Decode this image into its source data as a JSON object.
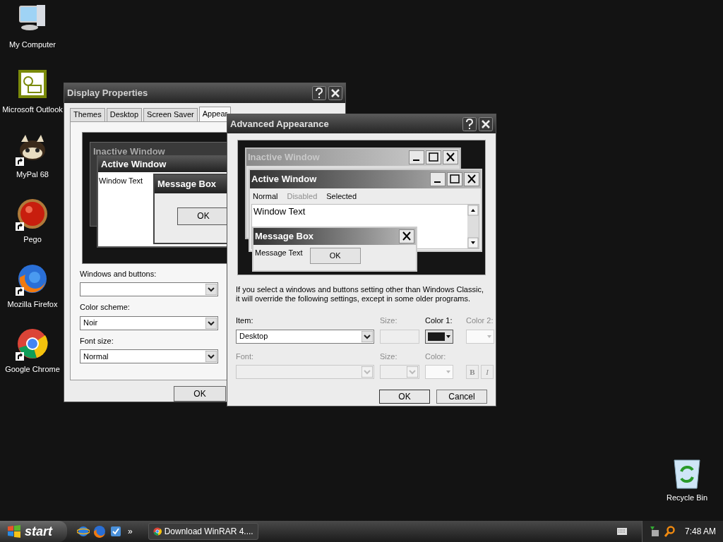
{
  "desktop_icons": [
    {
      "label": "My Computer",
      "kind": "computer",
      "shortcut": false
    },
    {
      "label": "Microsoft Outlook",
      "kind": "outlook",
      "shortcut": false
    },
    {
      "label": "MyPal 68",
      "kind": "raccoon",
      "shortcut": true
    },
    {
      "label": "Pego",
      "kind": "ball",
      "shortcut": true
    },
    {
      "label": "Mozilla Firefox",
      "kind": "firefox",
      "shortcut": true
    },
    {
      "label": "Google Chrome",
      "kind": "chrome",
      "shortcut": true
    }
  ],
  "recycle_bin": {
    "label": "Recycle Bin"
  },
  "display_properties": {
    "title": "Display Properties",
    "tabs": [
      {
        "label": "Themes",
        "selected": false
      },
      {
        "label": "Desktop",
        "selected": false
      },
      {
        "label": "Screen Saver",
        "selected": false
      },
      {
        "label": "Appear",
        "selected": true
      }
    ],
    "preview": {
      "inactive_title": "Inactive Window",
      "active_title": "Active Window",
      "window_text": "Window Text",
      "message_title": "Message Box",
      "ok": "OK"
    },
    "fields": [
      {
        "label": "Windows and buttons:"
      },
      {
        "label": "Color scheme:",
        "value": "Noir"
      },
      {
        "label": "Font size:",
        "value": "Normal"
      }
    ],
    "ok_button": "OK"
  },
  "advanced_appearance": {
    "title": "Advanced Appearance",
    "preview": {
      "inactive_title": "Inactive Window",
      "active_title": "Active Window",
      "menu": [
        {
          "label": "Normal",
          "kind": "normal"
        },
        {
          "label": "Disabled",
          "kind": "disabled"
        },
        {
          "label": "Selected",
          "kind": "selected"
        }
      ],
      "window_text": "Window Text",
      "message_title": "Message Box",
      "message_text": "Message Text",
      "ok": "OK"
    },
    "note": "If you select a windows and buttons setting other than Windows Classic, it will override the following settings, except in some older programs.",
    "item": {
      "label": "Item:",
      "value": "Desktop"
    },
    "item_size": {
      "label": "Size:",
      "disabled": true
    },
    "color1": {
      "label": "Color 1:",
      "color": "#1a1a1a",
      "disabled": false
    },
    "color2": {
      "label": "Color 2:",
      "disabled": true
    },
    "font": {
      "label": "Font:",
      "disabled": true
    },
    "font_size": {
      "label": "Size:",
      "disabled": true
    },
    "font_color": {
      "label": "Color:",
      "disabled": true
    },
    "bold": {
      "label": "B",
      "disabled": true
    },
    "italic": {
      "label": "I",
      "disabled": true
    },
    "buttons": [
      "OK",
      "Cancel"
    ]
  },
  "taskbar": {
    "start": "start",
    "chevron": "»",
    "tasks": [
      {
        "label": "Download WinRAR 4....",
        "selected": false
      }
    ],
    "clock": "7:48 AM"
  }
}
